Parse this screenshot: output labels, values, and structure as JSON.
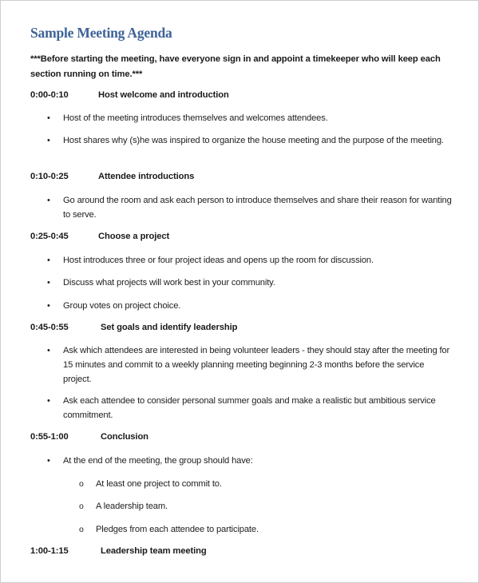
{
  "document": {
    "title": "Sample Meeting Agenda",
    "intro": "***Before starting the meeting, have everyone sign in and appoint a timekeeper who will keep each section running on time.***",
    "bullet_glyph": "•",
    "subbullet_glyph": "o",
    "title_color": "#3d6398",
    "sections": [
      {
        "time": "0:00-0:10",
        "heading": "Host welcome and introduction",
        "items": [
          {
            "text": "Host of the meeting introduces themselves and welcomes attendees."
          },
          {
            "text": "Host shares why (s)he was inspired to organize the house meeting and the purpose of the meeting."
          }
        ]
      },
      {
        "time": "0:10-0:25",
        "heading": "Attendee introductions",
        "items": [
          {
            "text": "Go around the room and ask each person to introduce themselves and share their reason for wanting to serve."
          }
        ]
      },
      {
        "time": "0:25-0:45",
        "heading": "Choose a project",
        "items": [
          {
            "text": "Host introduces three or four project ideas and opens up the room for discussion."
          },
          {
            "text": "Discuss what projects will work best in your community."
          },
          {
            "text": "Group votes on project choice."
          }
        ]
      },
      {
        "time": "0:45-0:55",
        "heading": "Set goals and identify leadership",
        "items": [
          {
            "text": "Ask which attendees are interested in being volunteer leaders - they should stay after the meeting for 15 minutes and commit to a weekly planning meeting beginning 2-3 months before the service project."
          },
          {
            "text": "Ask each attendee to consider personal summer goals and make a realistic but ambitious service commitment."
          }
        ]
      },
      {
        "time": "0:55-1:00",
        "heading": "Conclusion",
        "items": [
          {
            "text": "At the end of the meeting, the group should have:",
            "subitems": [
              "At least one project to commit to.",
              "A leadership team.",
              "Pledges from each attendee to participate."
            ]
          }
        ]
      },
      {
        "time": "1:00-1:15",
        "heading": "Leadership team meeting",
        "items": []
      }
    ]
  }
}
